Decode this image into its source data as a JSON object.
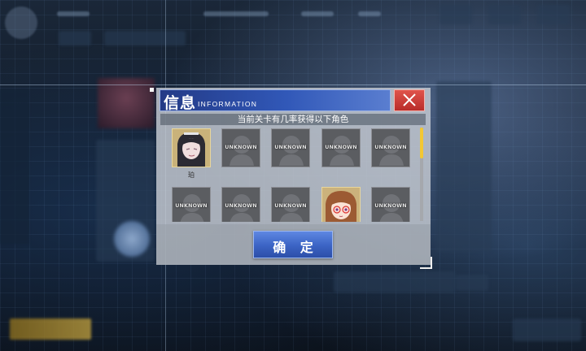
{
  "dialog": {
    "title": "信息",
    "title_en": "INFORMATION",
    "subtitle": "当前关卡有几率获得以下角色",
    "confirm_label": "确 定",
    "close_icon": "close-icon"
  },
  "characters": [
    {
      "label": "",
      "name": "珀",
      "known": true
    },
    {
      "label": "UNKNOWN",
      "name": "",
      "known": false
    },
    {
      "label": "UNKNOWN",
      "name": "",
      "known": false
    },
    {
      "label": "UNKNOWN",
      "name": "",
      "known": false
    },
    {
      "label": "UNKNOWN",
      "name": "",
      "known": false
    },
    {
      "label": "UNKNOWN",
      "name": "",
      "known": false
    },
    {
      "label": "UNKNOWN",
      "name": "",
      "known": false
    },
    {
      "label": "UNKNOWN",
      "name": "",
      "known": false
    },
    {
      "label": "",
      "name": "",
      "known": true
    },
    {
      "label": "UNKNOWN",
      "name": "",
      "known": false
    }
  ],
  "colors": {
    "header_blue": "#3158b8",
    "close_red": "#c93a35",
    "confirm_blue": "#3b63c4",
    "scroll_thumb": "#f2c733"
  }
}
